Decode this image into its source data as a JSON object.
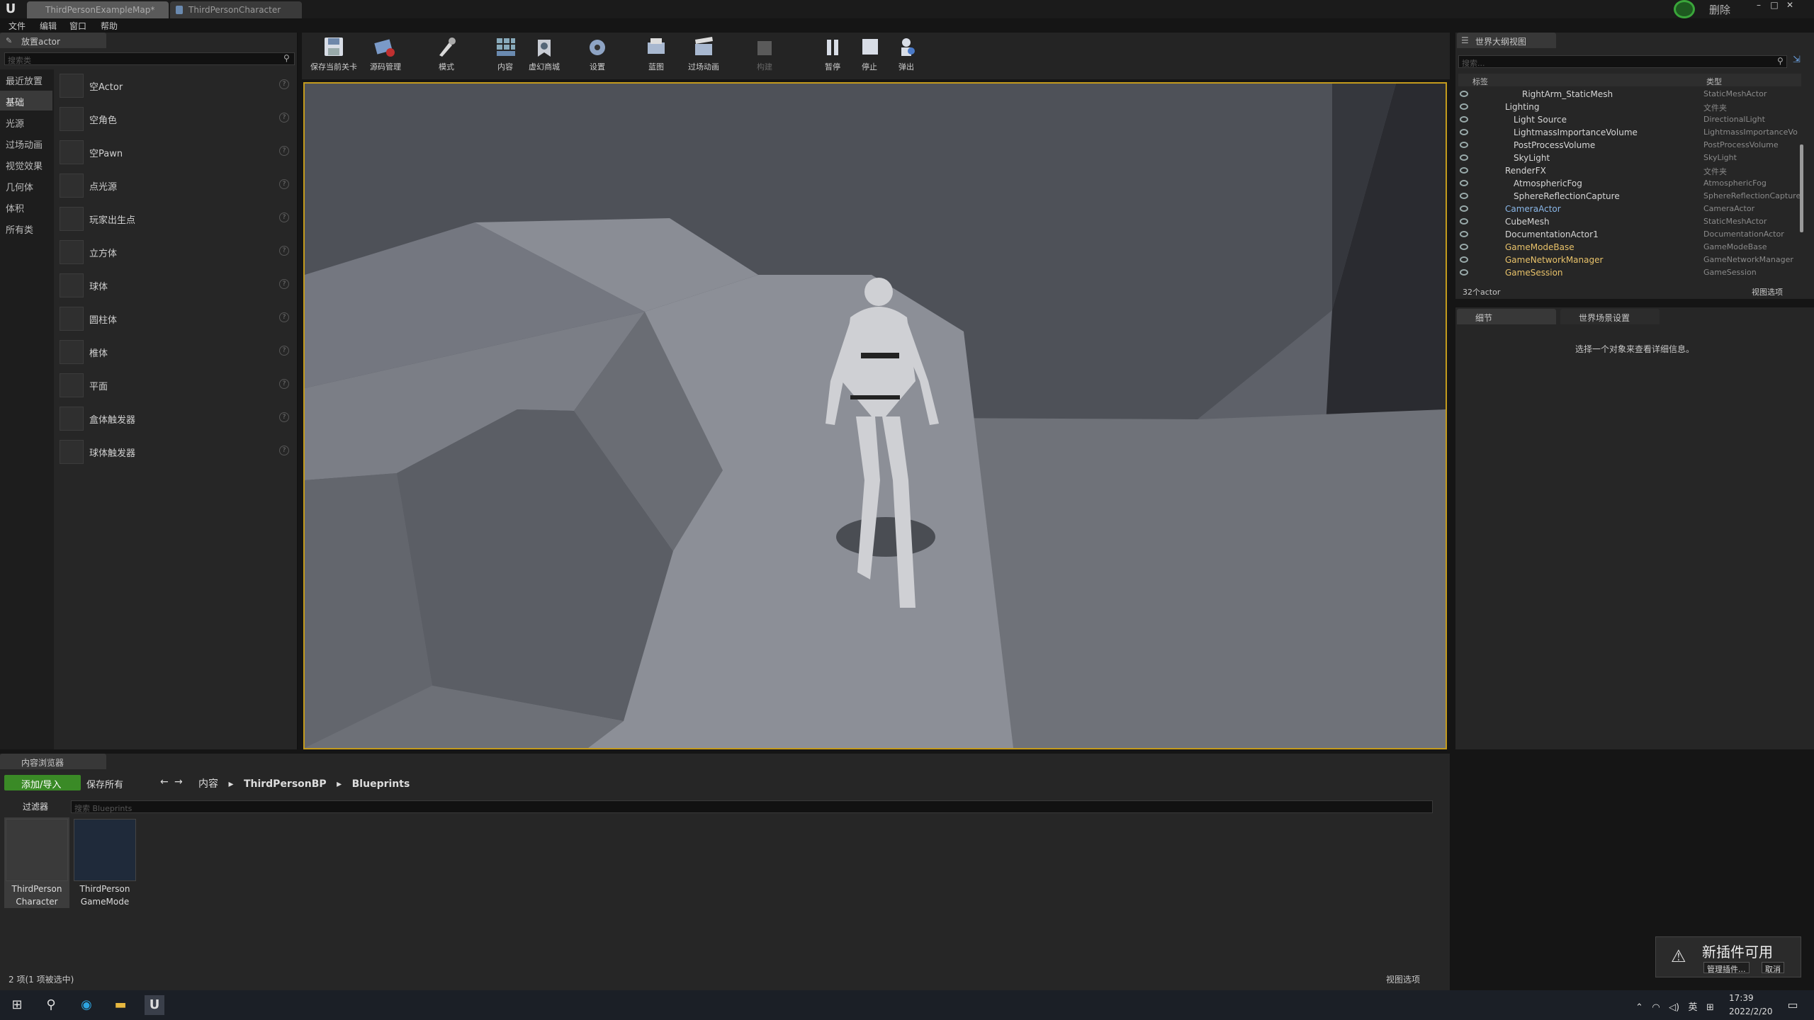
{
  "window": {
    "tabs": [
      "ThirdPersonExampleMap*",
      "ThirdPersonCharacter"
    ],
    "delete_label": "删除",
    "menu": [
      "文件",
      "编辑",
      "窗口",
      "帮助"
    ]
  },
  "place_panel": {
    "tab": "放置actor",
    "search_placeholder": "搜索类",
    "categories": [
      "最近放置",
      "基础",
      "光源",
      "过场动画",
      "视觉效果",
      "几何体",
      "体积",
      "所有类"
    ],
    "active_category": "基础",
    "items": [
      "空Actor",
      "空角色",
      "空Pawn",
      "点光源",
      "玩家出生点",
      "立方体",
      "球体",
      "圆柱体",
      "椎体",
      "平面",
      "盒体触发器",
      "球体触发器"
    ]
  },
  "toolbar": {
    "buttons": [
      "保存当前关卡",
      "源码管理",
      "模式",
      "内容",
      "虚幻商城",
      "设置",
      "蓝图",
      "过场动画",
      "构建",
      "暂停",
      "停止",
      "弹出"
    ]
  },
  "outliner": {
    "tab": "世界大纲视图",
    "search_placeholder": "搜索...",
    "col_label": "标签",
    "col_type": "类型",
    "rows": [
      {
        "name": "RightArm_StaticMesh",
        "type": "StaticMeshActor"
      },
      {
        "name": "Lighting",
        "type": "文件夹"
      },
      {
        "name": "Light Source",
        "type": "DirectionalLight"
      },
      {
        "name": "LightmassImportanceVolume",
        "type": "LightmassImportanceVo"
      },
      {
        "name": "PostProcessVolume",
        "type": "PostProcessVolume"
      },
      {
        "name": "SkyLight",
        "type": "SkyLight"
      },
      {
        "name": "RenderFX",
        "type": "文件夹"
      },
      {
        "name": "AtmosphericFog",
        "type": "AtmosphericFog"
      },
      {
        "name": "SphereReflectionCapture",
        "type": "SphereReflectionCapture"
      },
      {
        "name": "CameraActor",
        "type": "CameraActor"
      },
      {
        "name": "CubeMesh",
        "type": "StaticMeshActor"
      },
      {
        "name": "DocumentationActor1",
        "type": "DocumentationActor"
      },
      {
        "name": "GameModeBase",
        "type": "GameModeBase"
      },
      {
        "name": "GameNetworkManager",
        "type": "GameNetworkManager"
      },
      {
        "name": "GameSession",
        "type": "GameSession"
      }
    ],
    "count": "32个actor",
    "view_options": "视图选项"
  },
  "details": {
    "tab_details": "细节",
    "tab_world": "世界场景设置",
    "message": "选择一个对象来查看详细信息。"
  },
  "content_browser": {
    "tab": "内容浏览器",
    "add_import": "添加/导入",
    "save_all": "保存所有",
    "path": [
      "内容",
      "ThirdPersonBP",
      "Blueprints"
    ],
    "filters": "过滤器",
    "search_placeholder": "搜索 Blueprints",
    "assets": [
      {
        "line1": "ThirdPerson",
        "line2": "Character"
      },
      {
        "line1": "ThirdPerson",
        "line2": "GameMode"
      }
    ],
    "status": "2 项(1 项被选中)",
    "view_options": "视图选项"
  },
  "notification": {
    "title": "新插件可用",
    "manage": "管理插件...",
    "cancel": "取消"
  },
  "taskbar": {
    "time": "17:39",
    "date": "2022/2/20",
    "ime": "英"
  }
}
